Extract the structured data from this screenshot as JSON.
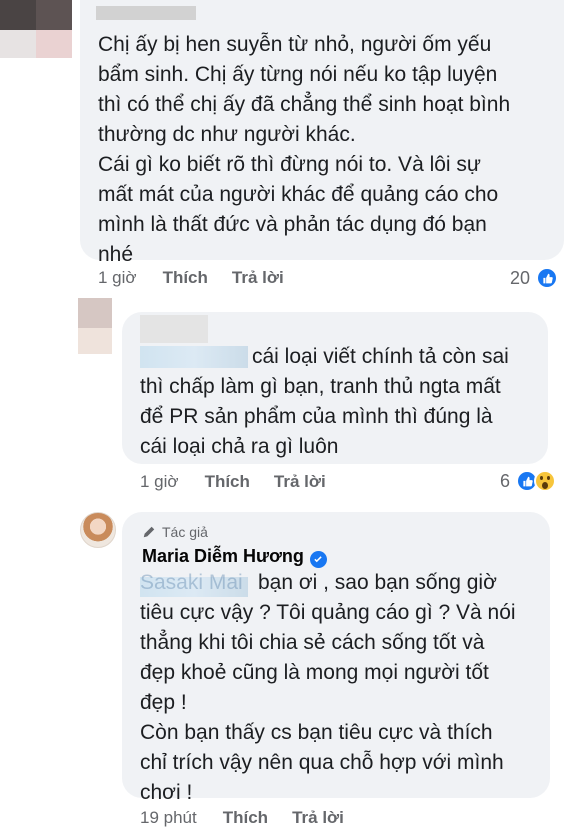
{
  "comments": [
    {
      "text": "Chị ấy bị hen suyễn từ nhỏ, người ốm yếu\nbẩm sinh. Chị ấy từng nói nếu ko tập luyện\nthì có thể chị ấy đã chẳng thể sinh hoạt bình\nthường dc như người khác.\nCái gì ko biết rõ thì đừng nói to. Và lôi sự\nmất mát của người khác để quảng cáo cho\nmình là thất đức và phản tác dụng đó bạn\nnhé",
      "time": "1 giờ",
      "like": "Thích",
      "reply": "Trả lời",
      "reaction_count": "20"
    },
    {
      "text": "cái loại viết chính tả còn sai\nthì chấp làm gì bạn, tranh thủ ngta mất\nđể PR sản phẩm của mình thì đúng là\ncái loại chả ra gì luôn",
      "time": "1 giờ",
      "like": "Thích",
      "reply": "Trả lời",
      "reaction_count": "6"
    },
    {
      "author_tag": "Tác giả",
      "author_name": "Maria Diễm Hương",
      "mention_partial": "Sasaki Mai",
      "text_first": "bạn ơi , sao bạn sống giờ",
      "text": "tiêu cực vậy ? Tôi quảng cáo gì ? Và nói\nthẳng khi tôi chia sẻ cách sống tốt và\nđẹp khoẻ cũng là mong mọi người tốt\nđẹp !\nCòn bạn thấy cs bạn tiêu cực và thích\nchỉ trích vậy nên qua chỗ hợp với mình\nchơi !",
      "time": "19 phút",
      "like": "Thích",
      "reply": "Trả lời"
    }
  ],
  "icons": [
    "like-reaction-icon",
    "wow-reaction-icon",
    "pencil-icon",
    "verified-badge-icon"
  ],
  "colors": {
    "bubble": "#f0f2f5",
    "meta": "#65676b",
    "facebook_blue": "#1877f2"
  }
}
